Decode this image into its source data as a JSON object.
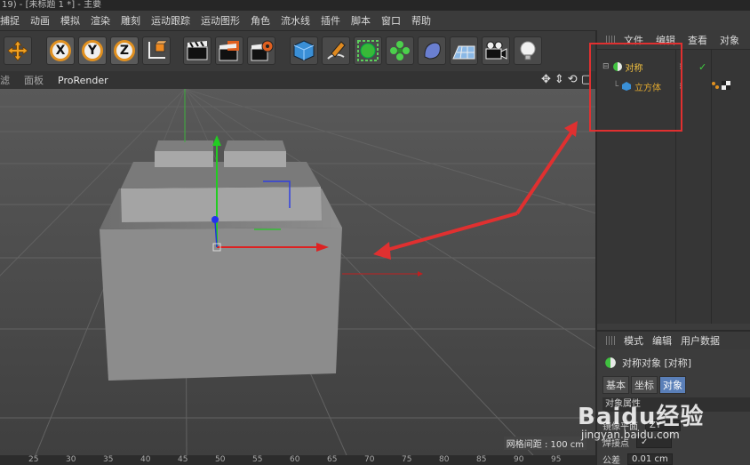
{
  "title": "19) - [未标题 1 *] - 主要",
  "menu": [
    "捕捉",
    "动画",
    "模拟",
    "渲染",
    "雕刻",
    "运动跟踪",
    "运动图形",
    "角色",
    "流水线",
    "插件",
    "脚本",
    "窗口",
    "帮助"
  ],
  "axis_buttons": [
    "X",
    "Y",
    "Z"
  ],
  "viewport_bar": {
    "items": [
      "滤",
      "面板"
    ],
    "prorender": "ProRender"
  },
  "viewport": {
    "grid_spacing": "网格间距 : 100 cm"
  },
  "ruler": [
    "25",
    "30",
    "35",
    "40",
    "45",
    "50",
    "55",
    "60",
    "65",
    "70",
    "75",
    "80",
    "85",
    "90",
    "95"
  ],
  "object_manager": {
    "tabs": [
      "文件",
      "编辑",
      "查看",
      "对象"
    ],
    "objects": [
      {
        "name": "对称",
        "icon": "symmetry-icon"
      },
      {
        "name": "立方体",
        "icon": "cube-icon"
      }
    ]
  },
  "attribute_manager": {
    "tabs": [
      "模式",
      "编辑",
      "用户数据"
    ],
    "object_title": "对称对象 [对称]",
    "subtabs": [
      "基本",
      "坐标",
      "对象"
    ],
    "active_subtab": "对象",
    "section": "对象属性",
    "fields": [
      {
        "label": "镜像平面",
        "value": "ZY"
      },
      {
        "label": "焊接点",
        "value": "✓"
      },
      {
        "label": "公差",
        "value": "0.01 cm"
      }
    ]
  },
  "watermark": {
    "brand": "Baidu经验",
    "url": "jingyan.baidu.com"
  },
  "colors": {
    "highlight_box": "#e03030",
    "arrow": "#e03030",
    "object_text": "#f0c040",
    "active_tab": "#5a7fb8"
  }
}
